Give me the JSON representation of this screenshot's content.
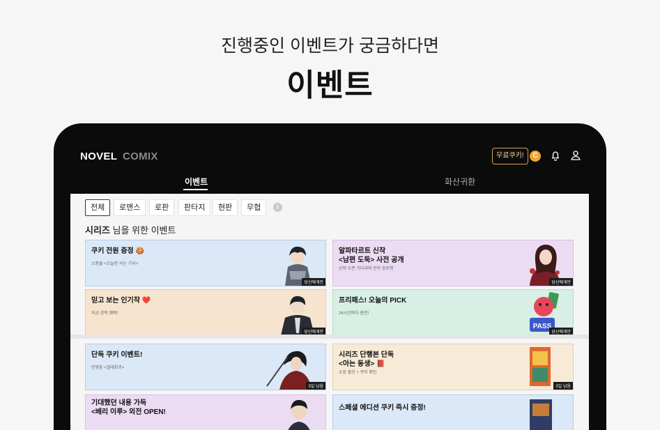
{
  "hero": {
    "subtitle": "진행중인 이벤트가 궁금하다면",
    "title": "이벤트"
  },
  "header": {
    "brand_novel": "NOVEL",
    "brand_comix": "COMIX",
    "free_cookie_label": "무료쿠키!",
    "coin_label": "C"
  },
  "tabs": [
    {
      "label": "이벤트",
      "active": true
    },
    {
      "label": "화산귀환",
      "active": false
    }
  ],
  "categories": [
    "전체",
    "로맨스",
    "로판",
    "판타지",
    "현판",
    "무협"
  ],
  "section": {
    "title_bold": "시리즈",
    "title_rest": " 님을 위한 이벤트"
  },
  "cards": [
    {
      "title": "쿠키 전원 증정 🍪",
      "subtitle": "소용돌 <오늘만 사는 기사>",
      "badge": "당신에게만",
      "theme": "blue"
    },
    {
      "title": "알파타르트 신작\n<남편 도둑> 사전 공개",
      "subtitle": "신작 오픈 기다리며 전작 정주행",
      "badge": "당신에게만",
      "theme": "purple"
    },
    {
      "title": "믿고 보는 인기작 ❤️",
      "subtitle": "지금 강력 혜택!",
      "badge": "당신에게만",
      "theme": "peach"
    },
    {
      "title": "프리패스! 오늘의 PICK",
      "subtitle": "24시간마다 충전!",
      "badge": "당신에게만",
      "theme": "mint"
    },
    {
      "title": "단독 쿠키 이벤트!",
      "subtitle": "진영훈 <절대회귀>",
      "badge": "3일 남음",
      "theme": "blue"
    },
    {
      "title": "시리즈 단행본 단독\n<아는 동생> 📕",
      "subtitle": "소장 할인 + 쿠키 확인",
      "badge": "3일 남음",
      "theme": "sand"
    },
    {
      "title": "기대했던 내용 가득\n<베리 이루> 외전 OPEN!",
      "subtitle": "",
      "badge": "",
      "theme": "purple"
    },
    {
      "title": "스페셜 에디션 쿠키 즉시 증정!",
      "subtitle": "",
      "badge": "",
      "theme": "blue"
    }
  ]
}
